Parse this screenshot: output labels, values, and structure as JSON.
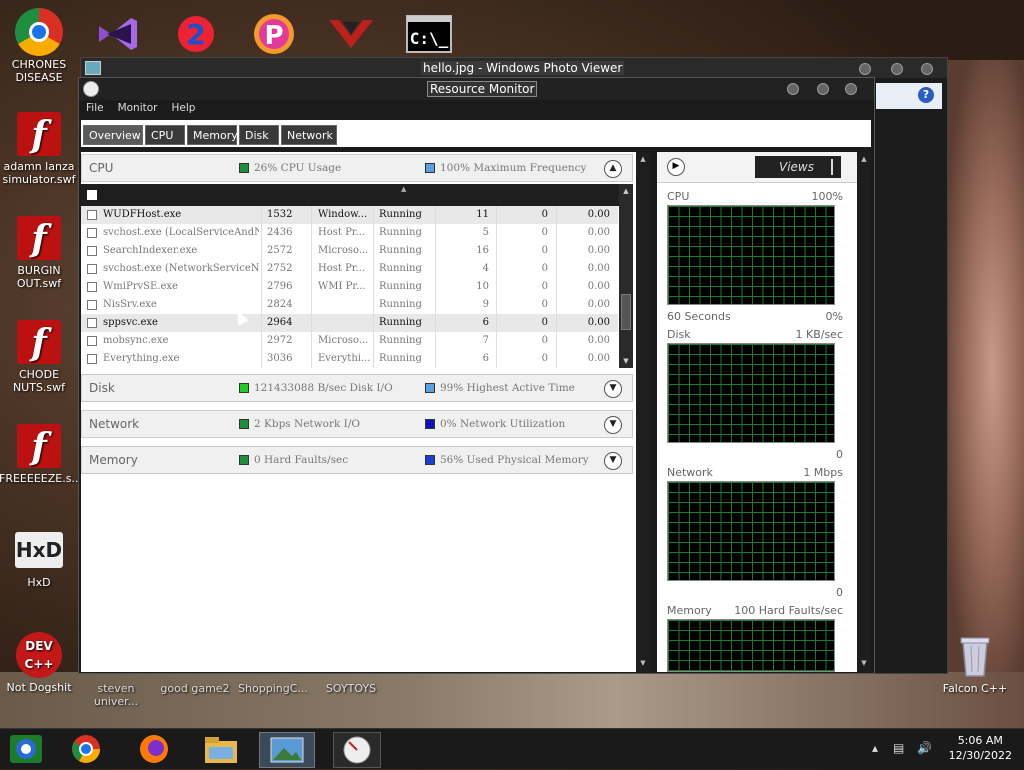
{
  "desktop_icons": [
    {
      "name": "chrones-disease",
      "label": "CHRONES DISEASE",
      "icon": "chrome-icon"
    },
    {
      "name": "adamn-lanza",
      "label": "adamn lanza simulator.swf",
      "icon": "flash-icon"
    },
    {
      "name": "burgin-out",
      "label": "BURGIN OUT.swf",
      "icon": "flash-icon"
    },
    {
      "name": "chode-nuts",
      "label": "CHODE NUTS.swf",
      "icon": "flash-icon"
    },
    {
      "name": "freeeeeze",
      "label": "FREEEEEZE.s...",
      "icon": "flash-icon"
    },
    {
      "name": "hxd",
      "label": "HxD",
      "icon": "hxd-icon"
    },
    {
      "name": "not-dogshit",
      "label": "Not Dogshit",
      "icon": "devcpp-icon"
    }
  ],
  "bottom_icons": [
    {
      "label": "steven univer..."
    },
    {
      "label": "good game2"
    },
    {
      "label": "ShoppingC..."
    },
    {
      "label": "SOYTOYS"
    }
  ],
  "recycle_bin": {
    "label": "Falcon C++"
  },
  "photo_viewer": {
    "title": "hello.jpg - Windows Photo Viewer"
  },
  "resource_monitor": {
    "title": "Resource Monitor",
    "menu": [
      "File",
      "Monitor",
      "Help"
    ],
    "tabs": [
      "Overview",
      "CPU",
      "Memory",
      "Disk",
      "Network"
    ],
    "cpu": {
      "label": "CPU",
      "usage": "26% CPU Usage",
      "freq": "100% Maximum Frequency",
      "usage_color": "#1f8f3a",
      "freq_color": "#5aa0e0",
      "rows": [
        {
          "image": "WUDFHost.exe",
          "pid": "1532",
          "desc": "Window...",
          "status": "Running",
          "threads": "11",
          "cpu": "0",
          "avg": "0.00"
        },
        {
          "image": "svchost.exe (LocalServiceAndN...",
          "pid": "2436",
          "desc": "Host Pr...",
          "status": "Running",
          "threads": "5",
          "cpu": "0",
          "avg": "0.00"
        },
        {
          "image": "SearchIndexer.exe",
          "pid": "2572",
          "desc": "Microso...",
          "status": "Running",
          "threads": "16",
          "cpu": "0",
          "avg": "0.00"
        },
        {
          "image": "svchost.exe (NetworkServiceN...",
          "pid": "2752",
          "desc": "Host Pr...",
          "status": "Running",
          "threads": "4",
          "cpu": "0",
          "avg": "0.00"
        },
        {
          "image": "WmiPrvSE.exe",
          "pid": "2796",
          "desc": "WMI Pr...",
          "status": "Running",
          "threads": "10",
          "cpu": "0",
          "avg": "0.00"
        },
        {
          "image": "NisSrv.exe",
          "pid": "2824",
          "desc": "",
          "status": "Running",
          "threads": "9",
          "cpu": "0",
          "avg": "0.00"
        },
        {
          "image": "sppsvc.exe",
          "pid": "2964",
          "desc": "",
          "status": "Running",
          "threads": "6",
          "cpu": "0",
          "avg": "0.00"
        },
        {
          "image": "mobsync.exe",
          "pid": "2972",
          "desc": "Microso...",
          "status": "Running",
          "threads": "7",
          "cpu": "0",
          "avg": "0.00"
        },
        {
          "image": "Everything.exe",
          "pid": "3036",
          "desc": "Everythi...",
          "status": "Running",
          "threads": "6",
          "cpu": "0",
          "avg": "0.00"
        }
      ]
    },
    "disk": {
      "label": "Disk",
      "io": "121433088 B/sec Disk I/O",
      "active": "99% Highest Active Time",
      "io_color": "#22cc22",
      "active_color": "#5aa0e0"
    },
    "network": {
      "label": "Network",
      "io": "2 Kbps Network I/O",
      "util": "0% Network Utilization",
      "io_color": "#1f8f3a",
      "util_color": "#1010c0"
    },
    "memory": {
      "label": "Memory",
      "faults": "0 Hard Faults/sec",
      "used": "56% Used Physical Memory",
      "faults_color": "#1f8f3a",
      "used_color": "#1a40d0"
    },
    "graphs": {
      "views_label": "Views",
      "cpu": {
        "label": "CPU",
        "max": "100%",
        "time": "60 Seconds",
        "min": "0%"
      },
      "disk": {
        "label": "Disk",
        "max": "1 KB/sec",
        "min": "0"
      },
      "network": {
        "label": "Network",
        "max": "1 Mbps",
        "min": "0"
      },
      "memory": {
        "label": "Memory",
        "max": "100 Hard Faults/sec"
      }
    }
  },
  "taskbar": {
    "time": "5:06 AM",
    "date": "12/30/2022"
  }
}
